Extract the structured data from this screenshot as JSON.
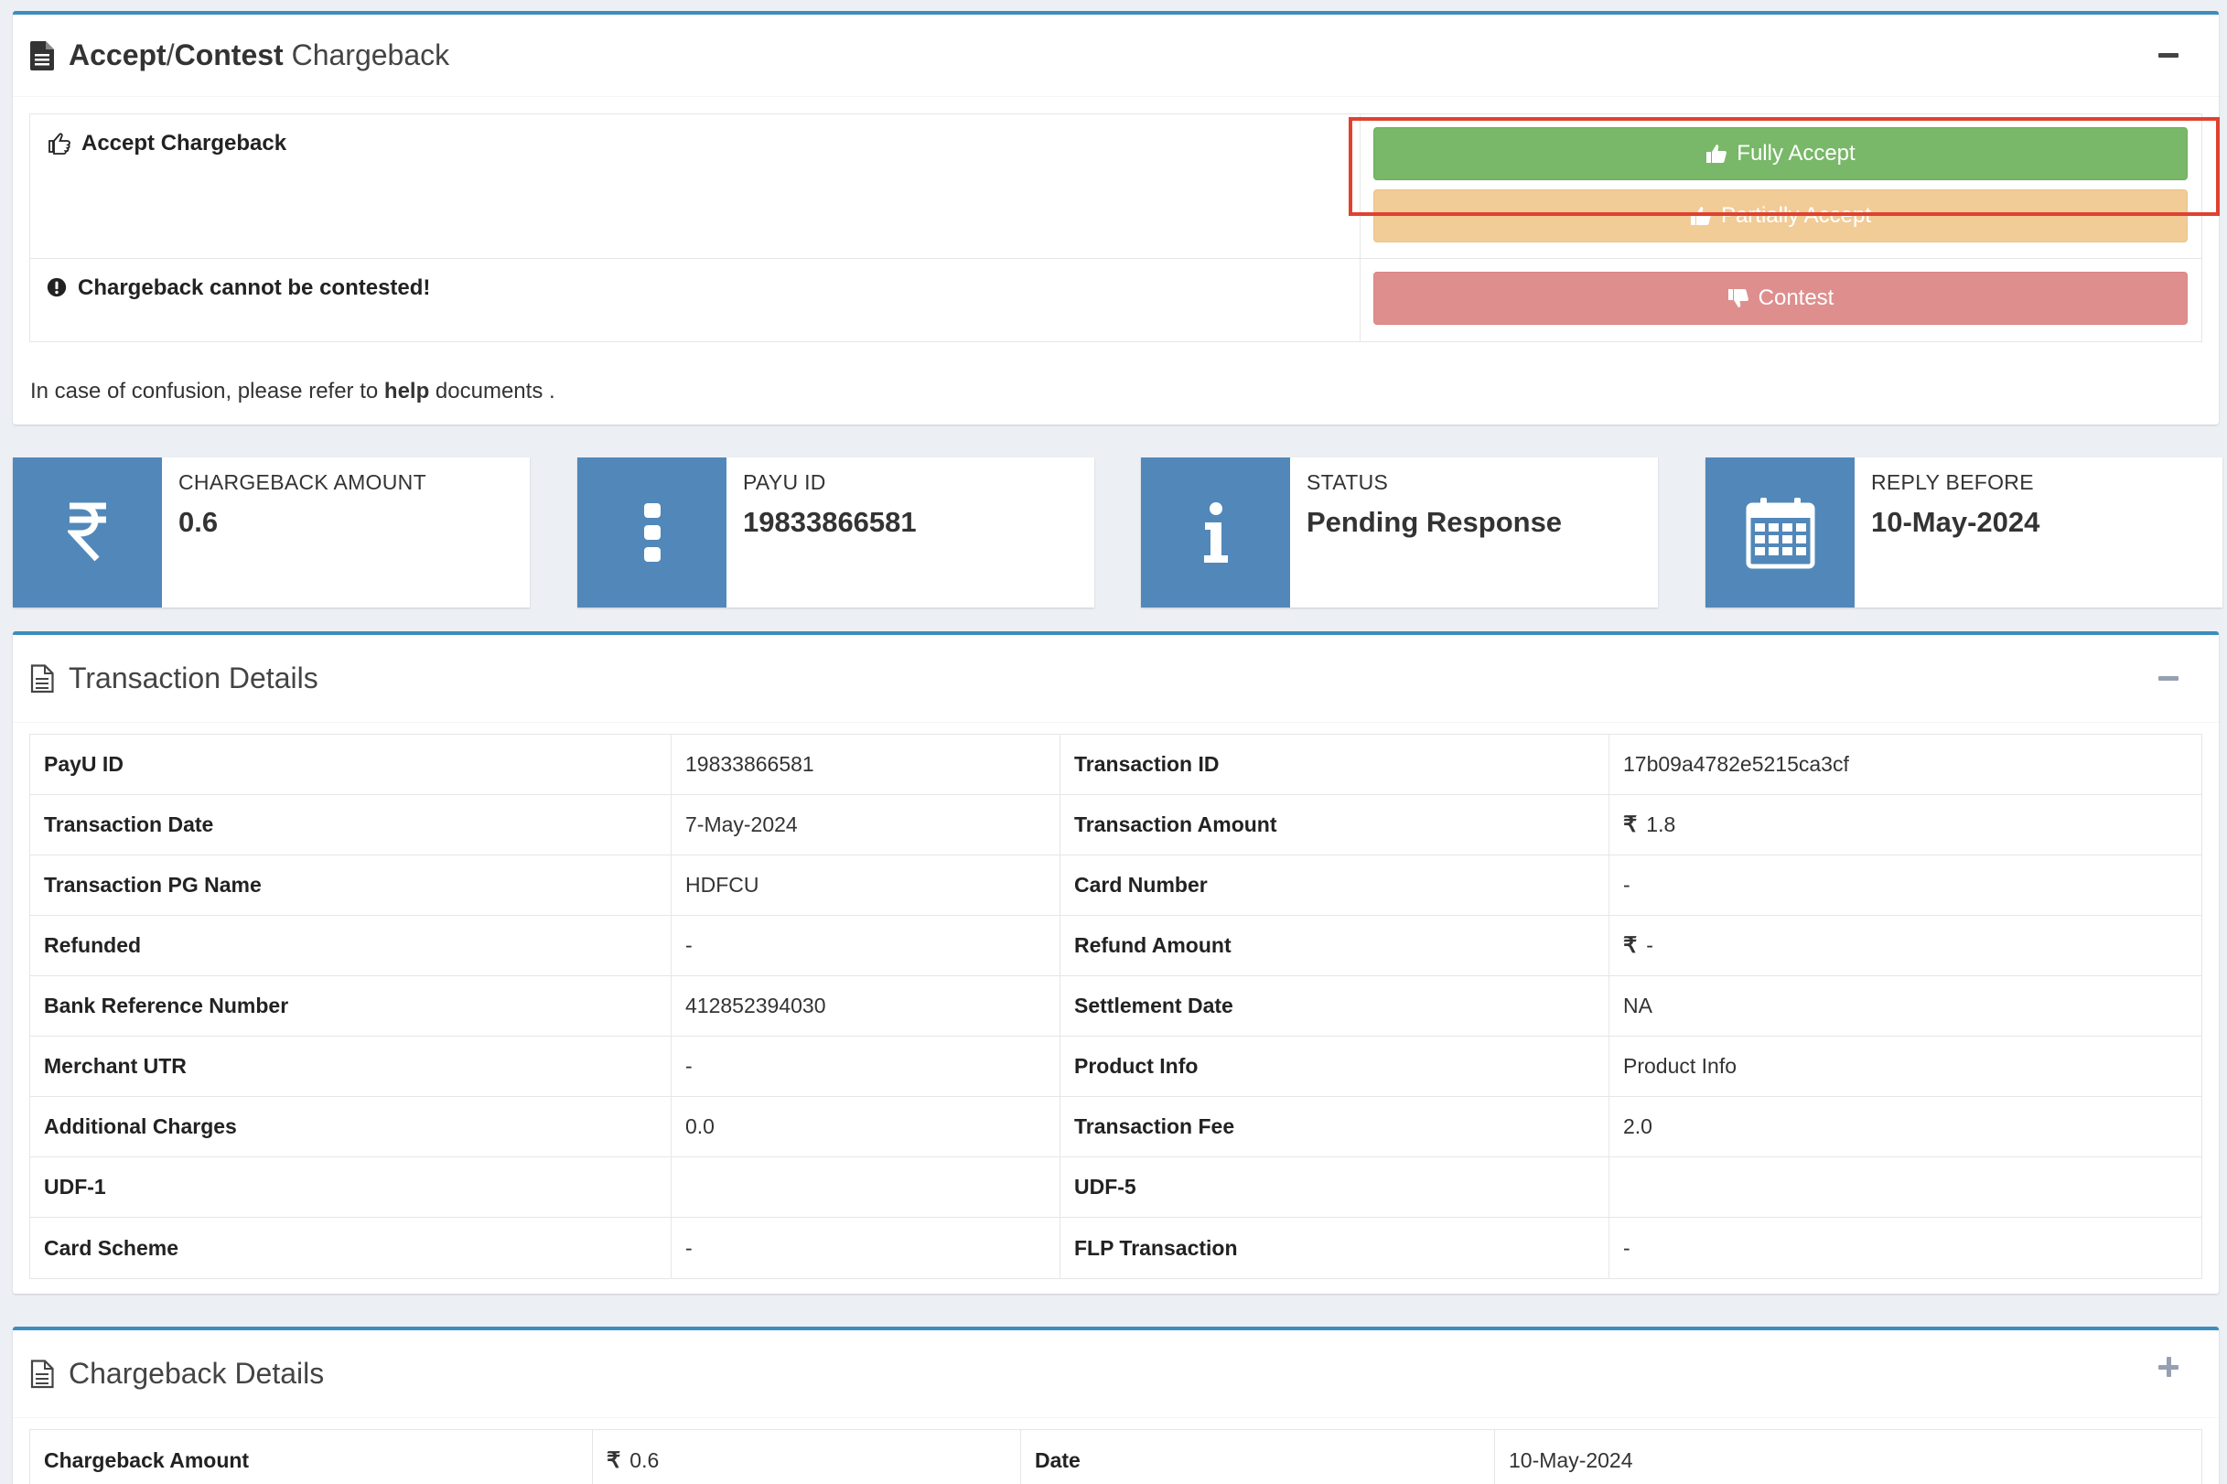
{
  "accept_contest": {
    "title_bold_1": "Accept",
    "title_sep": "/",
    "title_bold_2": "Contest",
    "title_rest": " Chargeback",
    "accept_label": "Accept Chargeback",
    "contest_label": "Chargeback cannot be contested!",
    "fully_accept": "Fully Accept",
    "partially_accept": "Partially Accept",
    "contest": "Contest",
    "note_prefix": "In case of confusion, please refer to ",
    "note_link": "help",
    "note_suffix": " documents ."
  },
  "info_boxes": [
    {
      "label": "CHARGEBACK AMOUNT",
      "value": "0.6",
      "icon": "rupee-icon"
    },
    {
      "label": "PAYU ID",
      "value": "19833866581",
      "icon": "vertical-dots-icon"
    },
    {
      "label": "STATUS",
      "value": "Pending Response",
      "icon": "info-icon"
    },
    {
      "label": "REPLY BEFORE",
      "value": "10-May-2024",
      "icon": "calendar-icon"
    }
  ],
  "transaction_details": {
    "title": "Transaction Details",
    "rows": [
      [
        "PayU ID",
        "19833866581",
        "Transaction ID",
        "17b09a4782e5215ca3cf"
      ],
      [
        "Transaction Date",
        "7-May-2024",
        "Transaction Amount",
        "1.8"
      ],
      [
        "Transaction PG Name",
        "HDFCU",
        "Card Number",
        "-"
      ],
      [
        "Refunded",
        "-",
        "Refund Amount",
        "-"
      ],
      [
        "Bank Reference Number",
        "412852394030",
        "Settlement Date",
        "NA"
      ],
      [
        "Merchant UTR",
        "-",
        "Product Info",
        "Product Info"
      ],
      [
        "Additional Charges",
        "0.0",
        "Transaction Fee",
        "2.0"
      ],
      [
        "UDF-1",
        "",
        "UDF-5",
        ""
      ],
      [
        "Card Scheme",
        "-",
        "FLP Transaction",
        "-"
      ]
    ],
    "rupee_symbol": "₹"
  },
  "chargeback_details": {
    "title": "Chargeback Details",
    "rows": [
      [
        "Chargeback Amount",
        "0.6",
        "Date",
        "10-May-2024"
      ]
    ]
  },
  "colors": {
    "box_border": "#3c8dbc",
    "info_icon_bg": "#5188b9",
    "fully_accept": "#78b868",
    "partially_accept": "#f1cc97",
    "contest": "#de8f8d",
    "highlight": "#e0412f"
  }
}
